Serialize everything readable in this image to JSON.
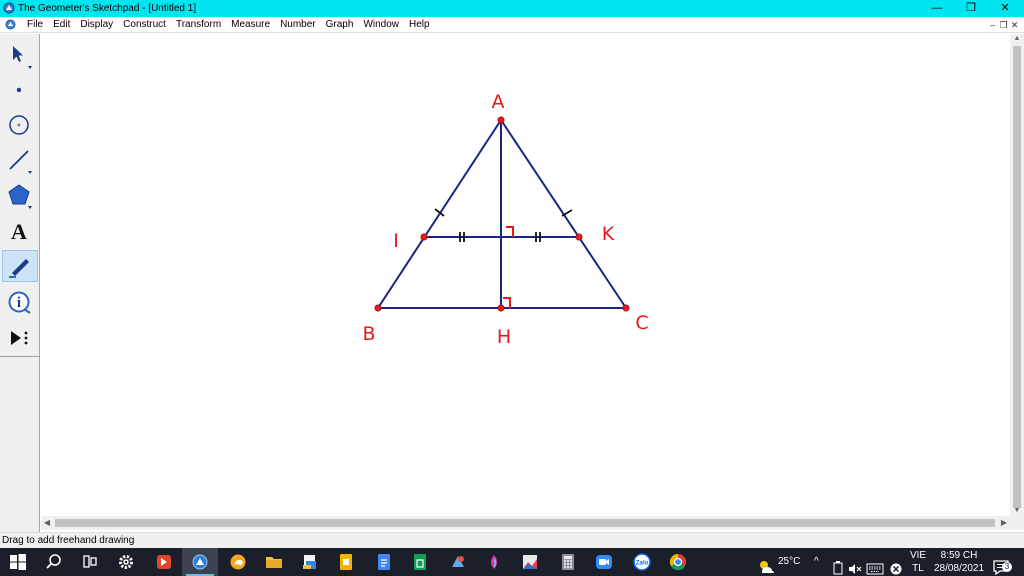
{
  "window": {
    "title": "The Geometer's Sketchpad - [Untitled 1]",
    "minimize_glyph": "—",
    "restore_glyph": "❐",
    "close_glyph": "✕"
  },
  "menu": {
    "items": [
      "File",
      "Edit",
      "Display",
      "Construct",
      "Transform",
      "Measure",
      "Number",
      "Graph",
      "Window",
      "Help"
    ],
    "mdi_minimize": "–",
    "mdi_restore": "❐",
    "mdi_close": "✕"
  },
  "toolbox": {
    "tools": [
      {
        "name": "arrow-select-tool",
        "icon": "arrow-pointer-icon"
      },
      {
        "name": "point-tool",
        "icon": "point-icon"
      },
      {
        "name": "compass-tool",
        "icon": "circle-icon"
      },
      {
        "name": "straightedge-tool",
        "icon": "line-segment-icon"
      },
      {
        "name": "polygon-tool",
        "icon": "pentagon-icon"
      },
      {
        "name": "text-tool",
        "icon": "letter-a-icon",
        "label": "A"
      },
      {
        "name": "marker-tool",
        "icon": "pen-icon",
        "active": true
      },
      {
        "name": "information-tool",
        "icon": "info-icon",
        "label": "i"
      },
      {
        "name": "custom-tool",
        "icon": "play-dots-icon"
      }
    ]
  },
  "sketch": {
    "stroke_color": "#1c2580",
    "point_color": "#e8191d",
    "points": {
      "A": "A",
      "B": "B",
      "C": "C",
      "H": "H",
      "I": "I",
      "K": "K"
    }
  },
  "status": {
    "text": "Drag to add freehand drawing"
  },
  "taskbar": {
    "apps": [
      "windows-start-icon",
      "search-icon",
      "task-view-icon",
      "settings-gear-icon",
      "app-icon",
      "sketchpad-icon",
      "browser-icon",
      "file-explorer-icon",
      "folder-icon",
      "docs-icon",
      "sheets-icon",
      "app-icon",
      "app-icon",
      "image-icon",
      "calculator-icon",
      "zoom-icon",
      "zalo-icon",
      "chrome-icon"
    ],
    "zalo_label": "Zalo",
    "weather": "25°C",
    "language_top": "VIE",
    "language_bottom": "TL",
    "time": "8:59 CH",
    "date": "28/08/2021",
    "notification_count": "3"
  }
}
